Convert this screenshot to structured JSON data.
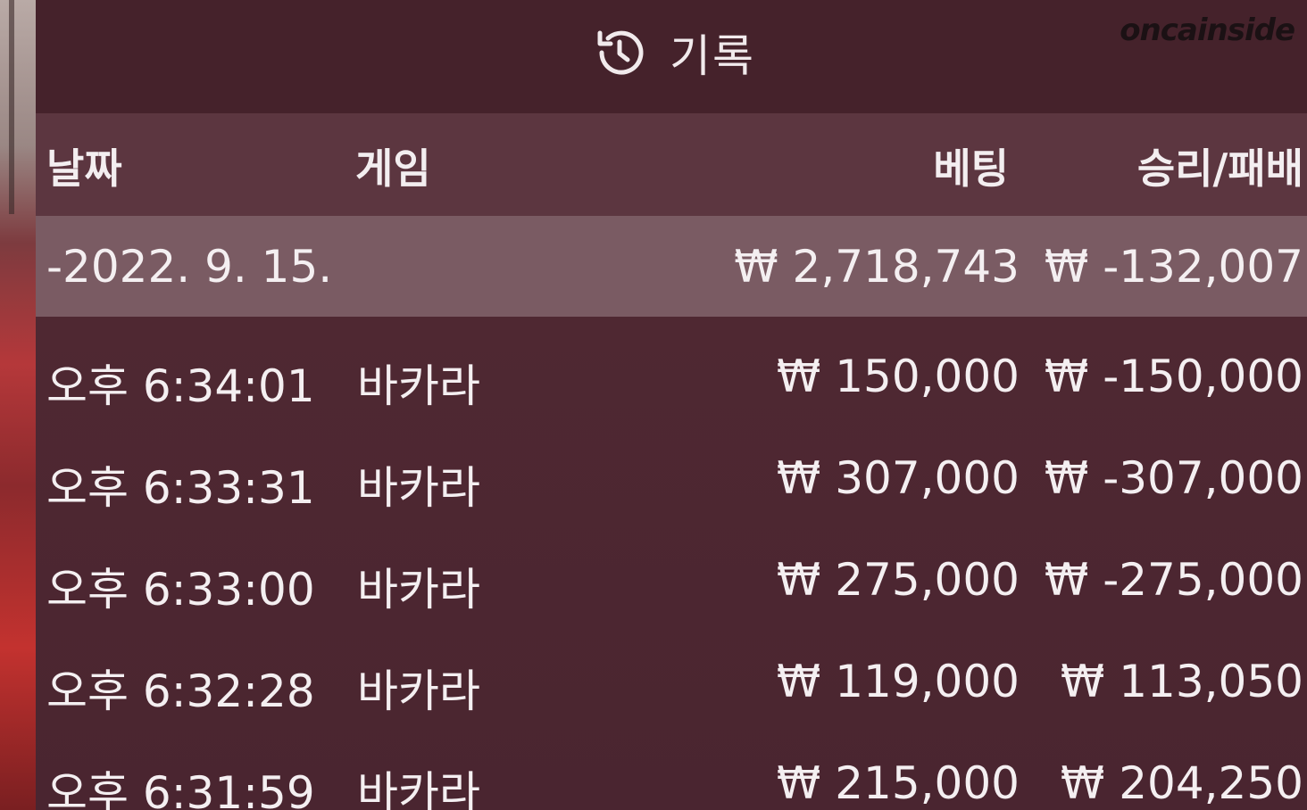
{
  "header": {
    "title": "기록",
    "icon": "history-icon",
    "watermark": "oncainside"
  },
  "columns": {
    "date": "날짜",
    "game": "게임",
    "bet": "베팅",
    "result": "승리/패배"
  },
  "summary": {
    "date": "-2022. 9. 15.",
    "bet": "₩ 2,718,743",
    "result": "₩ -132,007"
  },
  "rows": [
    {
      "time": "오후 6:34:01",
      "game": "바카라",
      "bet": "₩ 150,000",
      "result": "₩ -150,000"
    },
    {
      "time": "오후 6:33:31",
      "game": "바카라",
      "bet": "₩ 307,000",
      "result": "₩ -307,000"
    },
    {
      "time": "오후 6:33:00",
      "game": "바카라",
      "bet": "₩ 275,000",
      "result": "₩ -275,000"
    },
    {
      "time": "오후 6:32:28",
      "game": "바카라",
      "bet": "₩ 119,000",
      "result": "₩ 113,050"
    },
    {
      "time": "오후 6:31:59",
      "game": "바카라",
      "bet": "₩ 215,000",
      "result": "₩ 204,250"
    }
  ],
  "colors": {
    "panel": "#4b2630",
    "header_row": "#5c3640",
    "summary_row": "#7a5b63",
    "text": "#f4eff1"
  }
}
